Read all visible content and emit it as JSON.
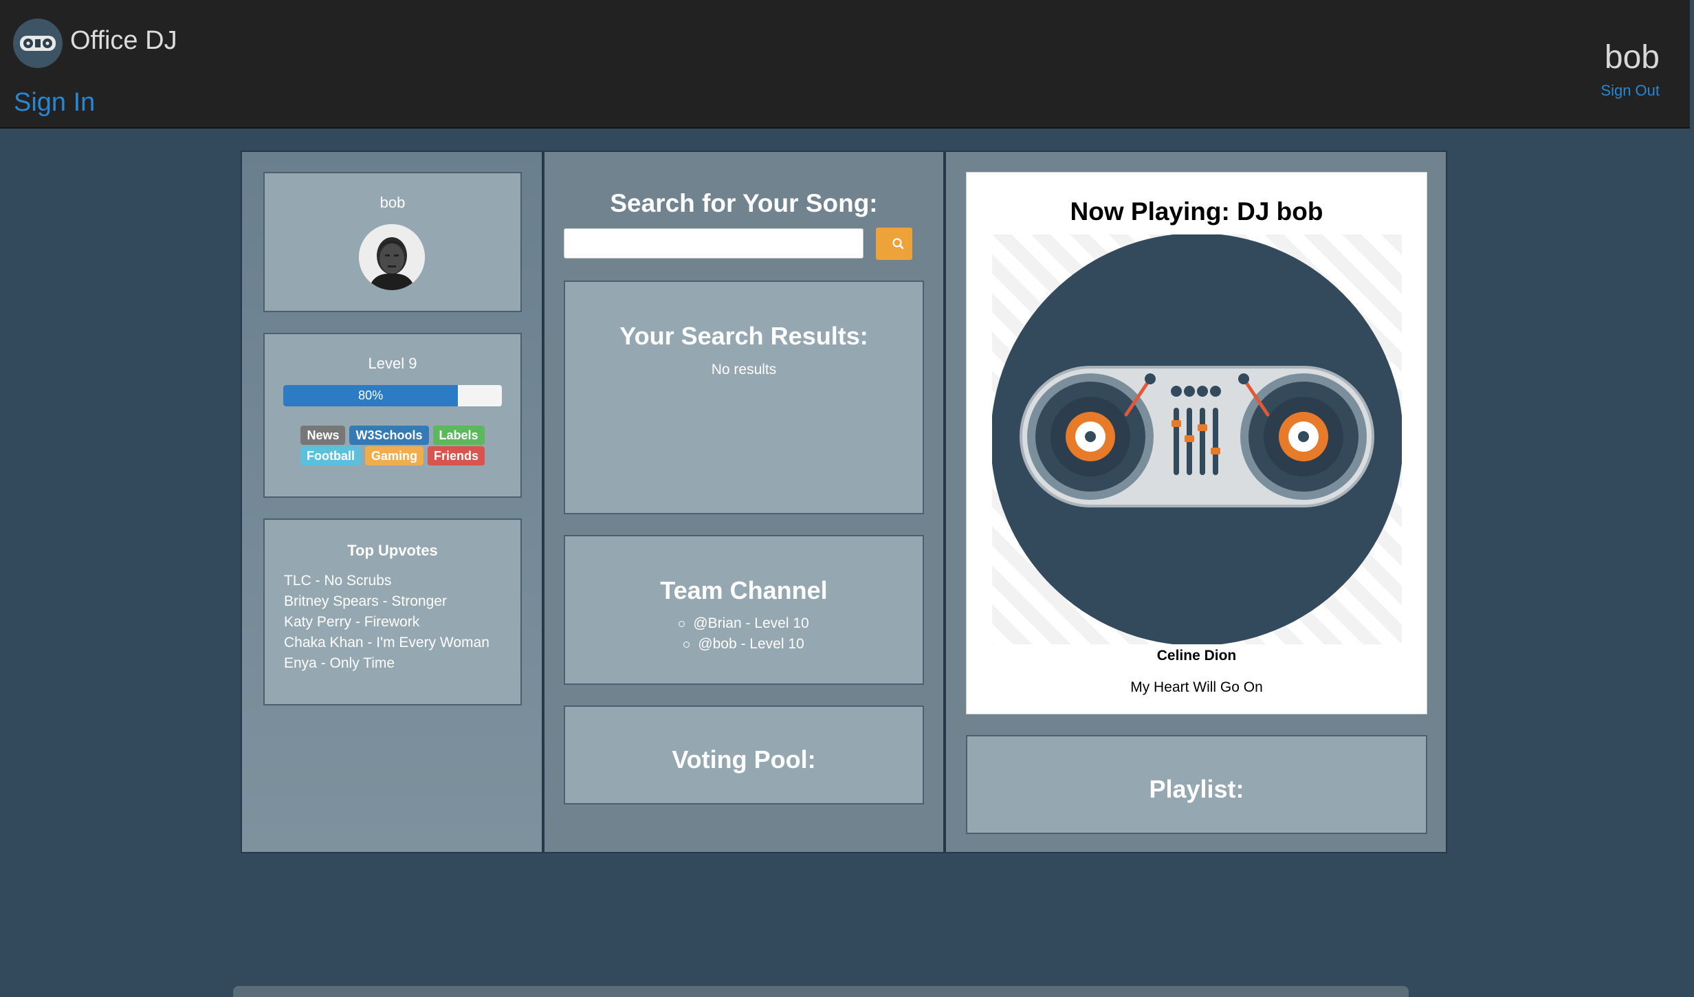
{
  "navbar": {
    "brand": "Office DJ",
    "sign_in": "Sign In",
    "username": "bob",
    "sign_out": "Sign Out"
  },
  "profile": {
    "name": "bob"
  },
  "level": {
    "title": "Level 9",
    "progress_percent": 80,
    "progress_label": "80%",
    "tags_row1": [
      {
        "label": "News",
        "color": "#777777"
      },
      {
        "label": "W3Schools",
        "color": "#337ab7"
      },
      {
        "label": "Labels",
        "color": "#5cb85c"
      }
    ],
    "tags_row2": [
      {
        "label": "Football",
        "color": "#5bc0de"
      },
      {
        "label": "Gaming",
        "color": "#f0ad4e"
      },
      {
        "label": "Friends",
        "color": "#d9534f"
      }
    ]
  },
  "upvotes": {
    "title": "Top Upvotes",
    "items": [
      "TLC - No Scrubs",
      "Britney Spears - Stronger",
      "Katy Perry - Firework",
      "Chaka Khan - I'm Every Woman",
      "Enya - Only Time"
    ]
  },
  "search": {
    "title": "Search for Your Song:",
    "placeholder": "",
    "button_icon": "search-icon"
  },
  "results": {
    "title": "Your Search Results:",
    "empty": "No results"
  },
  "team": {
    "title": "Team Channel",
    "members": [
      "@Brian - Level 10",
      "@bob - Level 10"
    ]
  },
  "voting": {
    "title": "Voting Pool:"
  },
  "now_playing": {
    "title": "Now Playing: DJ bob",
    "artist": "Celine Dion",
    "track": "My Heart Will Go On"
  },
  "playlist": {
    "title": "Playlist:"
  },
  "colors": {
    "accent_blue": "#2a86d0",
    "search_button": "#eea23a",
    "progress_fill": "#2b7cc5"
  }
}
